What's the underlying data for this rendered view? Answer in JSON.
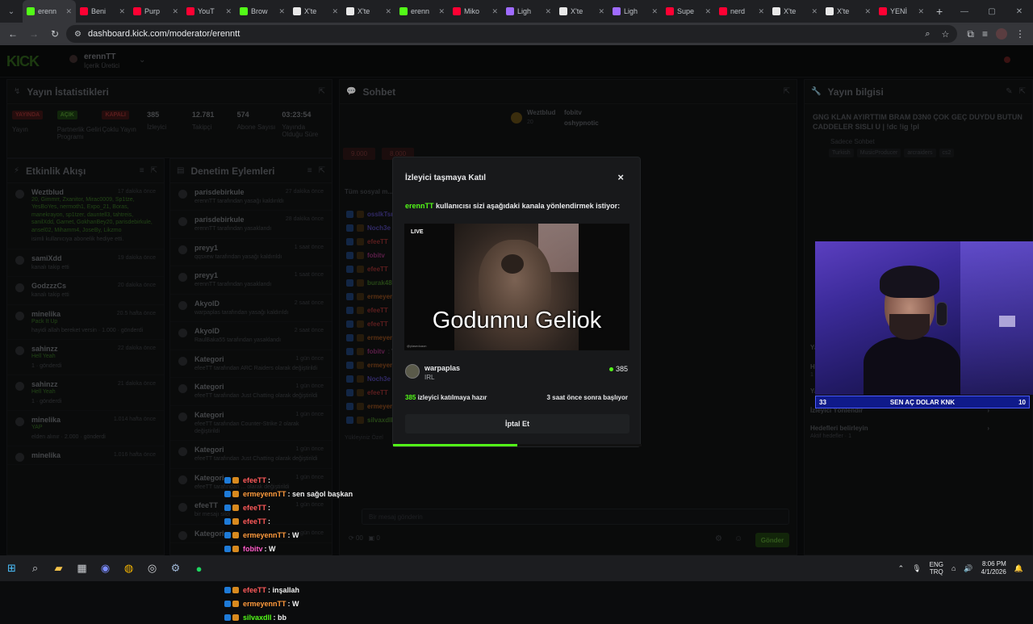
{
  "browser": {
    "tabs": [
      {
        "label": "erenn",
        "color": "#53fc18",
        "active": true
      },
      {
        "label": "Beni",
        "color": "#ff0033"
      },
      {
        "label": "Purp",
        "color": "#ff0033"
      },
      {
        "label": "YouT",
        "color": "#ff0033"
      },
      {
        "label": "Brow",
        "color": "#53fc18"
      },
      {
        "label": "X'te",
        "color": "#e8e8e8"
      },
      {
        "label": "X'te",
        "color": "#e8e8e8"
      },
      {
        "label": "erenn",
        "color": "#53fc18"
      },
      {
        "label": "Miko",
        "color": "#ff0033"
      },
      {
        "label": "Ligh",
        "color": "#9f6bff"
      },
      {
        "label": "X'te",
        "color": "#e8e8e8"
      },
      {
        "label": "Ligh",
        "color": "#9f6bff"
      },
      {
        "label": "Supe",
        "color": "#ff0033"
      },
      {
        "label": "nerd",
        "color": "#ff0033"
      },
      {
        "label": "X'te",
        "color": "#e8e8e8"
      },
      {
        "label": "X'te",
        "color": "#e8e8e8"
      },
      {
        "label": "YENİ",
        "color": "#ff0033"
      }
    ],
    "url": "dashboard.kick.com/moderator/erenntt"
  },
  "topnav": {
    "logo": "KICK",
    "channel_name": "erennTT",
    "channel_role": "İçerik Üretici"
  },
  "stats_panel": {
    "title": "Yayın İstatistikleri",
    "items": [
      {
        "chip": "YAYINDA",
        "chip_color": "red",
        "label": "Yayın"
      },
      {
        "chip": "AÇIK",
        "chip_color": "green",
        "label": "Partnerlik Geliri Programı"
      },
      {
        "chip": "KAPALI",
        "chip_color": "red",
        "label": "Çoklu Yayın"
      },
      {
        "value": "385",
        "label": "İzleyici"
      },
      {
        "value": "12.781",
        "label": "Takipçi"
      },
      {
        "value": "574",
        "label": "Abone Sayısı"
      },
      {
        "value": "03:23:54",
        "label": "Yayında Olduğu Süre"
      }
    ]
  },
  "activity_panel": {
    "title": "Etkinlik Akışı",
    "items": [
      {
        "name": "Weztblud",
        "time": "17 dakika önce",
        "green": "20, Gimmrr, Zxanitor, Mirac0009, Sp1tze, YesBoYes, nermoth1, Expo_21, Boras, manekrayon, sp1tzer, dauntell3, tahtreis, sanilXdd, Garnet, GokhanBey20, parisdebirkule, ansel02, Mihamm4, JoseBy, Likzmo",
        "sub": "isimli kullanıcıya abonelik hediye etti."
      },
      {
        "name": "samiXdd",
        "time": "19 dakika önce",
        "sub": "kanalı takip etti"
      },
      {
        "name": "GodzzzCs",
        "time": "20 dakika önce",
        "sub": "kanalı takip etti"
      },
      {
        "name": "minelika",
        "time": "20.5 hafta önce",
        "green": "Pack It Up",
        "sub": "hayidi allah bereket versin · 1.000 · gönderdi"
      },
      {
        "name": "sahinzz",
        "time": "22 dakika önce",
        "green": "Hell Yeah",
        "sub": "1 · gönderdi"
      },
      {
        "name": "sahinzz",
        "time": "21 dakika önce",
        "green": "Hell Yeah",
        "sub": "1 · gönderdi"
      },
      {
        "name": "minelika",
        "time": "1.014 hafta önce",
        "green": "YAP",
        "sub": "elden alınır · 2.000 · gönderdi"
      },
      {
        "name": "minelika",
        "time": "1.016 hafta önce",
        "sub": ""
      }
    ]
  },
  "mod_panel": {
    "title": "Denetim Eylemleri",
    "items": [
      {
        "name": "parisdebirkule",
        "time": "27 dakika önce",
        "sub": "erennTT tarafından yasağı kaldırıldı"
      },
      {
        "name": "parisdebirkule",
        "time": "28 dakika önce",
        "sub": "erennTT tarafından yasaklandı"
      },
      {
        "name": "preyy1",
        "time": "1 saat önce",
        "sub": "qqsxew tarafından yasağı kaldırıldı"
      },
      {
        "name": "preyy1",
        "time": "1 saat önce",
        "sub": "erennTT tarafından yasaklandı"
      },
      {
        "name": "AkyolD",
        "time": "2 saat önce",
        "sub": "warpaplas tarafından yasağı kaldırıldı"
      },
      {
        "name": "AkyolD",
        "time": "2 saat önce",
        "sub": "RaulBaka55 tarafından yasaklandı"
      },
      {
        "name": "Kategori",
        "time": "1 gün önce",
        "sub": "efeeTT tarafından ARC Raiders olarak değiştirildi"
      },
      {
        "name": "Kategori",
        "time": "1 gün önce",
        "sub": "efeeTT tarafından Just Chatting olarak değiştirildi"
      },
      {
        "name": "Kategori",
        "time": "1 gün önce",
        "sub": "efeeTT tarafından Counter-Strike 2 olarak değiştirildi"
      },
      {
        "name": "Kategori",
        "time": "1 gün önce",
        "sub": "efeeTT tarafından Just Chatting olarak değiştirildi"
      },
      {
        "name": "Kategori",
        "time": "1 gün önce",
        "sub": "efeeTT tarafından ... olarak değiştirildi"
      },
      {
        "name": "efeeTT",
        "time": "1 gün önce",
        "sub": "bir mesajı sildi"
      },
      {
        "name": "Kategori",
        "time": "1 gün önce",
        "sub": ""
      }
    ]
  },
  "chat_panel": {
    "title": "Sohbet",
    "pinned_user": "Weztblud",
    "pinned_sub": "20",
    "top_users": [
      "fobitv",
      "oshypnotic"
    ],
    "hype_chips": [
      "9.000",
      "8.000"
    ],
    "social_label": "Tüm sosyal m...",
    "rows": [
      {
        "user": "osslkTsrb",
        "color": "#4a3f9a",
        "msg": ""
      },
      {
        "user": "Noch3e",
        "color": "#4a3f9a",
        "msg": ""
      },
      {
        "user": "efeeTT",
        "color": "#8a2d2d",
        "msg": ""
      },
      {
        "user": "fobitv",
        "color": "#8a2d6d",
        "msg": ""
      },
      {
        "user": "efeeTT",
        "color": "#8a2d2d",
        "msg": ""
      },
      {
        "user": "burak4809",
        "color": "#3b6b22",
        "msg": ""
      },
      {
        "user": "ermeyennTT",
        "color": "#8a4a1c",
        "msg": ""
      },
      {
        "user": "efeeTT",
        "color": "#8a2d2d",
        "msg": ""
      },
      {
        "user": "efeeTT",
        "color": "#8a2d2d",
        "msg": ""
      },
      {
        "user": "ermeyennTT",
        "color": "#8a4a1c",
        "msg": ""
      },
      {
        "user": "fobitv",
        "color": "#8a2d6d",
        "msg": ": W"
      },
      {
        "user": "ermeyennTT",
        "color": "#8a4a1c",
        "msg": ""
      },
      {
        "user": "Noch3e",
        "color": "#4a3f9a",
        "msg": ""
      },
      {
        "user": "efeeTT",
        "color": "#8a2d2d",
        "msg": ""
      },
      {
        "user": "ermeyennTT",
        "color": "#8a4a1c",
        "msg": ": W"
      },
      {
        "user": "silvaxdll",
        "color": "#3b6b22",
        "msg": ": bb"
      }
    ],
    "more_label": "Yükleyiniz Özel",
    "input_placeholder": "Bir mesaj gönderin",
    "send_label": "Gönder",
    "footer_count": "00",
    "footer_count2": "0"
  },
  "info_panel": {
    "title": "Yayın bilgisi",
    "stream_title": "GNG KLAN AYIRTTIM BRAM D3N0 ÇOK GEÇ DUYDU BUTUN CADDELER SISLI U | !dc !ig !pl",
    "chat_mode": "Sadece Sohbet",
    "tags": [
      "Turkish",
      "MusicProducer",
      "arcraiders",
      "cs2"
    ],
    "menu": [
      {
        "label": "Yapay Zeka ile Sohbet Denetimi",
        "sub": ""
      },
      {
        "label": "Hesap yaşı kısıtlaması",
        "sub": "1 gün"
      },
      {
        "label": "Yasaklanmış kelimeler",
        "sub": ""
      },
      {
        "label": "İzleyici Yönlendir",
        "sub": ""
      },
      {
        "label": "Hedefleri belirleyin",
        "sub": "Aktif hedefler · 1"
      }
    ]
  },
  "modal": {
    "title": "İzleyici taşmaya Katıl",
    "close_icon": "×",
    "desc_user": "erennTT",
    "desc_text": " kullanıcısı sizi aşağıdaki kanala yönlendirmek istiyor:",
    "live_label": "LIVE",
    "caption": "Godunnu Geliok",
    "preview_small": "@ylaseduaon",
    "target_name": "warpaplas",
    "target_category": "IRL",
    "target_viewers": "385",
    "ready_count": "385",
    "ready_text": " izleyici katılmaya hazır",
    "start_text": "3 saat önce sonra başlıyor",
    "cancel_label": "İptal Et",
    "progress": 0.5
  },
  "overlay_chat": [
    {
      "user": "efeeTT",
      "color": "#ff5a5a",
      "msg": ":"
    },
    {
      "user": "ermeyennTT",
      "color": "#ff9a3c",
      "msg": ": sen sağol başkan"
    },
    {
      "user": "efeeTT",
      "color": "#ff5a5a",
      "msg": ":"
    },
    {
      "user": "efeeTT",
      "color": "#ff5a5a",
      "msg": ":"
    },
    {
      "user": "ermeyennTT",
      "color": "#ff9a3c",
      "msg": ": W"
    },
    {
      "user": "fobitv",
      "color": "#ff5ac8",
      "msg": ": W"
    },
    {
      "user": "ermeyennTT",
      "color": "#ff9a3c",
      "msg": ": W"
    },
    {
      "user": "Noch3e",
      "color": "#8b7bff",
      "msg": ": W"
    },
    {
      "user": "efeeTT",
      "color": "#ff5a5a",
      "msg": ": inşallah"
    },
    {
      "user": "ermeyennTT",
      "color": "#ff9a3c",
      "msg": ": W"
    },
    {
      "user": "silvaxdll",
      "color": "#53fc18",
      "msg": ": bb"
    }
  ],
  "goal_bar": {
    "left": "33",
    "text": "SEN AÇ DOLAR KNK",
    "right": "10"
  },
  "taskbar": {
    "lang_top": "ENG",
    "lang_bottom": "TRQ",
    "time": "8:06 PM",
    "date": "4/1/2026"
  }
}
